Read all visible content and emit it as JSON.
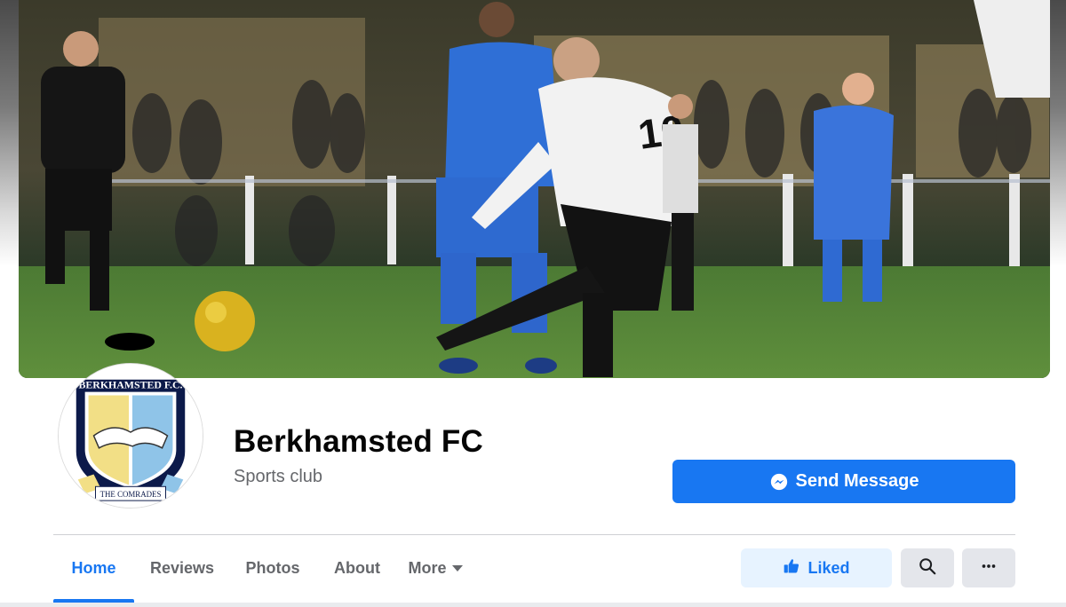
{
  "page": {
    "name": "Berkhamsted FC",
    "category": "Sports club"
  },
  "cover": {
    "player_number": "10"
  },
  "logo": {
    "top_text": "BERKHAMSTED F.C.",
    "motto": "THE COMRADES"
  },
  "actions": {
    "send_message_label": "Send Message",
    "liked_label": "Liked"
  },
  "tabs": [
    {
      "label": "Home",
      "active": true
    },
    {
      "label": "Reviews",
      "active": false
    },
    {
      "label": "Photos",
      "active": false
    },
    {
      "label": "About",
      "active": false
    },
    {
      "label": "More",
      "active": false
    }
  ],
  "colors": {
    "accent": "#1877f2",
    "liked_bg": "#e7f3ff",
    "secondary_text": "#65676b",
    "icon_button_bg": "#e4e6eb"
  }
}
